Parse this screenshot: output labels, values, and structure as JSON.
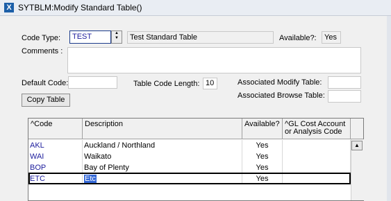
{
  "window": {
    "title": "SYTBLM:Modify Standard Table()"
  },
  "form": {
    "code_type_label": "Code Type:",
    "code_type_value": "TEST",
    "code_type_description": "Test Standard Table",
    "available_label": "Available?:",
    "available_value": "Yes",
    "comments_label": "Comments :",
    "comments_value": "",
    "default_code_label": "Default Code:",
    "default_code_value": "",
    "table_code_length_label": "Table Code Length:",
    "table_code_length_value": "10",
    "associated_modify_label": "Associated Modify Table:",
    "associated_modify_value": "",
    "associated_browse_label": "Associated Browse Table:",
    "associated_browse_value": "",
    "copy_table_button": "Copy Table"
  },
  "grid": {
    "columns": [
      "^Code",
      "Description",
      "Available?",
      "^GL Cost Account or Analysis Code"
    ],
    "rows": [
      {
        "code": "AKL",
        "description": "Auckland / Northland",
        "available": "Yes",
        "gl": ""
      },
      {
        "code": "WAI",
        "description": "Waikato",
        "available": "Yes",
        "gl": ""
      },
      {
        "code": "BOP",
        "description": "Bay of Plenty",
        "available": "Yes",
        "gl": ""
      },
      {
        "code": "ETC",
        "description": "Etc",
        "available": "Yes",
        "gl": ""
      }
    ],
    "selected_row_index": 3
  },
  "icons": {
    "app": "app-icon",
    "scroll_up": "scroll-up-arrow-icon",
    "spin_up": "spin-up-icon",
    "spin_down": "spin-down-icon"
  }
}
